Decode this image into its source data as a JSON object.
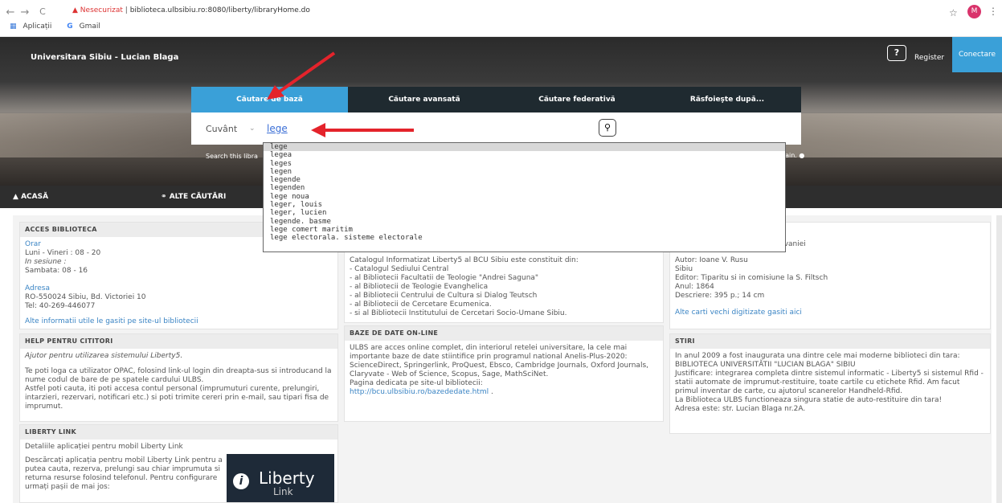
{
  "browser": {
    "back": "←",
    "forward": "→",
    "reload": "C",
    "warning": "▲",
    "insecure_label": "Nesecurizat",
    "separator": "|",
    "url": "biblioteca.ulbsibiu.ro:8080/liberty/libraryHome.do",
    "star": "☆",
    "profile_initial": "M",
    "menu": "⋮",
    "bookmarks": [
      {
        "icon": "▦",
        "label": "Aplicații"
      },
      {
        "icon": "G",
        "label": "Gmail"
      }
    ]
  },
  "header": {
    "brand": "Universitara Sibiu - Lucian Blaga",
    "help": "?",
    "register": "Register",
    "login": "Conectare"
  },
  "search": {
    "tabs": [
      "Căutare de bază",
      "Căutare avansată",
      "Căutare federativă",
      "Răsfoieşte după..."
    ],
    "field_label": "Cuvânt",
    "field_chevron": "⌄",
    "query": "lege",
    "button_icon": "⚲",
    "library_text": "Search this libra",
    "again_text": "gain.",
    "suggestions": [
      "lege",
      "legea",
      "leges",
      "legen",
      "legende",
      "legenden",
      "lege noua",
      "leger, louis",
      "leger, lucien",
      "legende. basme",
      "lege comert maritim",
      "lege electorala. sisteme electorale"
    ]
  },
  "menubar": {
    "home": "ACASĂ",
    "other": "ALTE CĂUTĂRI"
  },
  "left": {
    "acces_title": "ACCES BIBLIOTECA",
    "orar_link": "Orar",
    "orar_1": "Luni - Vineri : 08 - 20",
    "orar_2": "In sesiune :",
    "orar_3": "Sambata: 08 - 16",
    "adresa_link": "Adresa",
    "adresa_1": "RO-550024 Sibiu, Bd. Victoriei 10",
    "adresa_2": "Tel: 40-269-446077",
    "info_link": "Alte informatii utile le gasiti pe site-ul bibliotecii",
    "help_title": "HELP PENTRU CITITORI",
    "help_1": "Ajutor pentru utilizarea sistemului Liberty5.",
    "help_2": "Te poti loga ca utilizator OPAC, folosind link-ul login din dreapta-sus si introducand la nume codul de bare de pe spatele cardului ULBS.",
    "help_3": "Astfel poti cauta, iti poti accesa contul personal (imprumuturi curente, prelungiri, intarzieri, rezervari, notificari etc.) si poti trimite cereri prin e-mail, sau tipari fisa de imprumut.",
    "liberty_title": "LIBERTY LINK",
    "liberty_1": "Detaliile aplicației pentru mobil Liberty Link",
    "liberty_2": "Descărcați aplicația pentru mobil Liberty Link pentru a putea cauta, rezerva, prelungi sau chiar imprumuta si returna resurse folosind telefonul. Pentru configurare urmați pașii de mai jos:",
    "logo_i": "i",
    "logo_t1": "Liberty",
    "logo_t2": "Link"
  },
  "middle": {
    "catalog_intro": "Catalogul Informatizat Liberty5 al BCU Sibiu este constituit din:",
    "catalog_items": [
      "- Catalogul Sediului Central",
      "- al Bibliotecii Facultatii de Teologie \"Andrei Saguna\"",
      "- al Bibliotecii de Teologie Evanghelica",
      "- al Bibliotecii Centrului de Cultura si Dialog Teutsch",
      "- al Bibliotecii de Cercetare Ecumenica.",
      "- si al Bibliotecii Institutului de Cercetari Socio-Umane Sibiu."
    ],
    "baze_title": "BAZE DE DATE ON-LINE",
    "baze_text": "ULBS are acces online complet, din interiorul retelei universitare, la cele mai importante baze de date stiintifice prin programul national Anelis-Plus-2020: ScienceDirect, Springerlink, ProQuest, Ebsco, Cambridge Journals, Oxford Journals, Claryvate - Web of Science, Scopus, Sage, MathSciNet.",
    "baze_page": "Pagina dedicata pe site-ul bibliotecii:",
    "baze_link": "http://bcu.ulbsibiu.ro/bazededate.html",
    "baze_dot": "."
  },
  "right": {
    "book_title_tail": "silvaniei",
    "autor": "Autor: Ioane V. Rusu",
    "loc": "Sibiu",
    "editor": "Editor: Tiparitu si in comisiune la S. Filtsch",
    "anul": "Anul: 1864",
    "descriere": "Descriere: 395 p.; 14 cm",
    "carti_link": "Alte carti vechi digitizate gasiti aici",
    "stiri_title": "STIRI",
    "stiri_1": "In anul 2009 a fost inaugurata una dintre cele mai moderne biblioteci din tara:",
    "stiri_2": "BIBLIOTECA UNIVERSITĂTII \"LUCIAN BLAGA\" SIBIU",
    "stiri_3": "Justificare: integrarea completa dintre sistemul informatic - Liberty5 si sistemul Rfid - statii automate de imprumut-restituire, toate cartile cu etichete Rfid. Am facut primul inventar de carte, cu ajutorul scanerelor Handheld-Rfid.",
    "stiri_4": "La Biblioteca ULBS functioneaza singura statie de auto-restituire din tara!",
    "stiri_5": "Adresa este: str. Lucian Blaga nr.2A."
  },
  "colors": {
    "accent": "#3aa0d8",
    "arrow": "#e4232b",
    "link": "#3a84c4"
  }
}
